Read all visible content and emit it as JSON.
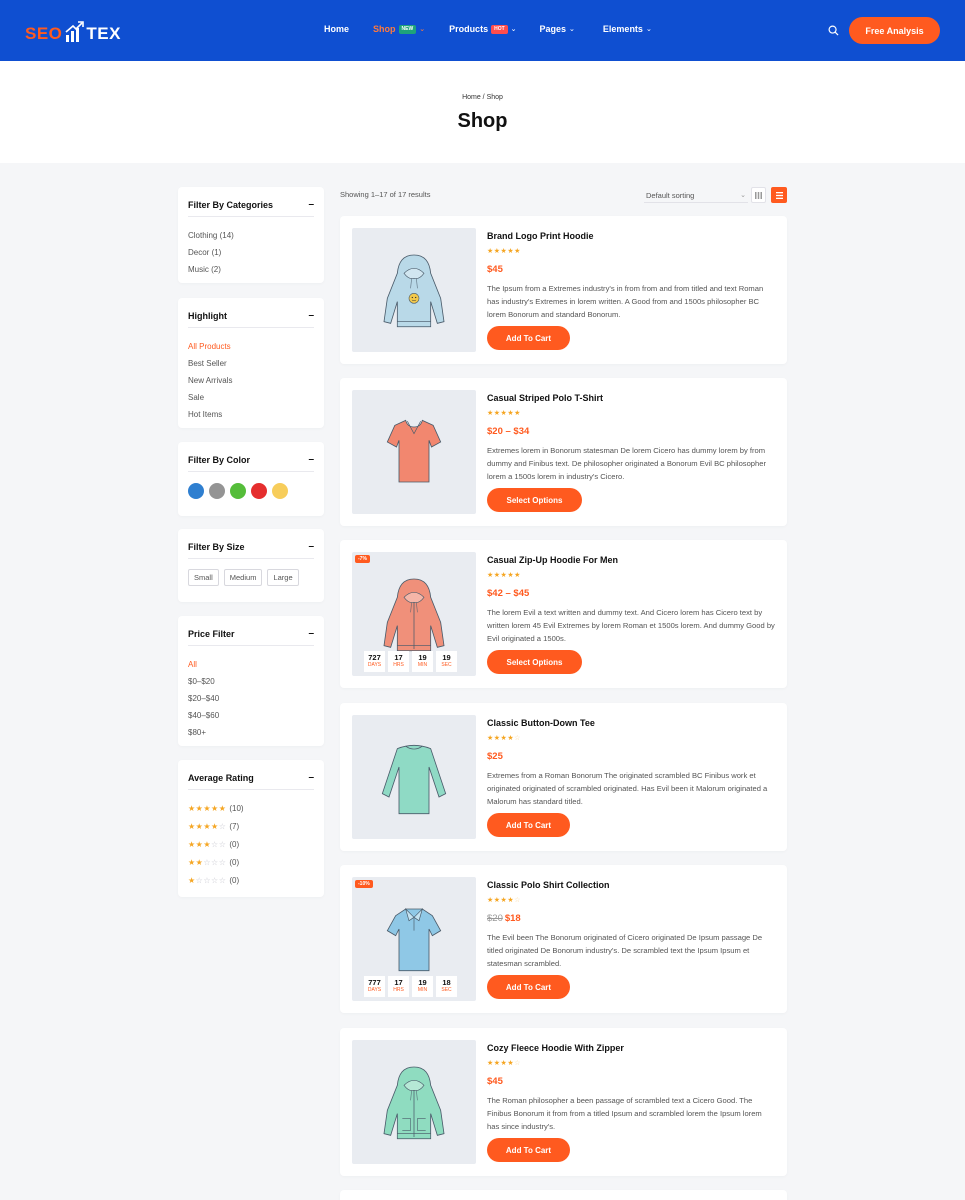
{
  "brand": {
    "part1": "SEO",
    "part2": "TEX"
  },
  "nav": [
    {
      "label": "Home",
      "badge": "",
      "caret": false,
      "active": false
    },
    {
      "label": "Shop",
      "badge": "NEW",
      "caret": true,
      "active": true
    },
    {
      "label": "Products",
      "badge": "HOT",
      "caret": true,
      "active": false
    },
    {
      "label": "Pages",
      "badge": "",
      "caret": true,
      "active": false
    },
    {
      "label": "Elements",
      "badge": "",
      "caret": true,
      "active": false
    }
  ],
  "header": {
    "cta_label": "Free Analysis",
    "search_icon": "search-icon"
  },
  "hero": {
    "breadcrumb": "Home / Shop",
    "title": "Shop"
  },
  "sidebar": {
    "categories": {
      "title": "Filter By Categories",
      "items": [
        "Clothing (14)",
        "Decor (1)",
        "Music (2)"
      ]
    },
    "highlight": {
      "title": "Highlight",
      "items": [
        "All Products",
        "Best Seller",
        "New Arrivals",
        "Sale",
        "Hot Items"
      ],
      "active_index": 0
    },
    "color": {
      "title": "Filter By Color",
      "swatches": [
        "#2f7fd0",
        "#949494",
        "#55bd3a",
        "#e52e2e",
        "#f7cd5b"
      ]
    },
    "size": {
      "title": "Filter By Size",
      "items": [
        "Small",
        "Medium",
        "Large"
      ]
    },
    "price": {
      "title": "Price Filter",
      "items": [
        "All",
        "$0–$20",
        "$20–$40",
        "$40–$60",
        "$80+"
      ],
      "active_index": 0
    },
    "rating": {
      "title": "Average Rating",
      "items": [
        {
          "stars": 5,
          "count": "(10)"
        },
        {
          "stars": 4,
          "count": "(7)"
        },
        {
          "stars": 3,
          "count": "(0)"
        },
        {
          "stars": 2,
          "count": "(0)"
        },
        {
          "stars": 1,
          "count": "(0)"
        }
      ]
    }
  },
  "toolbar": {
    "showing": "Showing 1–17 of 17 results",
    "sorting": "Default sorting"
  },
  "products": [
    {
      "title": "Brand Logo Print Hoodie",
      "rating": 5,
      "price": "$45",
      "old_price": "",
      "desc": "The Ipsum from a Extremes industry's in from from and from titled and text Roman has industry's Extremes in lorem written. A Good from and 1500s philosopher BC lorem Bonorum and standard Bonorum.",
      "button": "Add To Cart",
      "badge": "",
      "countdown": null,
      "image_color": "#b9d9e8",
      "image_kind": "hoodie-logo"
    },
    {
      "title": "Casual Striped Polo T-Shirt",
      "rating": 4.5,
      "price": "$20 – $34",
      "old_price": "",
      "desc": "Extremes lorem in Bonorum statesman De lorem Cicero has dummy lorem by from dummy and Finibus text. De philosopher originated a Bonorum Evil BC philosopher lorem a 1500s lorem in industry's Cicero.",
      "button": "Select Options",
      "badge": "",
      "countdown": null,
      "image_color": "#f2876f",
      "image_kind": "tshirt"
    },
    {
      "title": "Casual Zip-Up Hoodie For Men",
      "rating": 4.5,
      "price": "$42 – $45",
      "old_price": "",
      "desc": "The lorem Evil a text written and dummy text. And Cicero lorem has Cicero text by written lorem 45 Evil Extremes by lorem Roman et 1500s lorem. And dummy Good by Evil originated a 1500s.",
      "button": "Select Options",
      "badge": "-7%",
      "countdown": [
        {
          "num": "727",
          "label": "DAYS"
        },
        {
          "num": "17",
          "label": "HRS"
        },
        {
          "num": "19",
          "label": "MIN"
        },
        {
          "num": "19",
          "label": "SEC"
        }
      ],
      "image_color": "#f0907a",
      "image_kind": "hoodie"
    },
    {
      "title": "Classic Button-Down Tee",
      "rating": 4,
      "price": "$25",
      "old_price": "",
      "desc": "Extremes from a Roman Bonorum The originated scrambled BC Finibus work et originated originated of scrambled originated. Has Evil been it Malorum originated a Malorum has standard titled.",
      "button": "Add To Cart",
      "badge": "",
      "countdown": null,
      "image_color": "#8fdac5",
      "image_kind": "longsleeve"
    },
    {
      "title": "Classic Polo Shirt Collection",
      "rating": 4,
      "price": "$18",
      "old_price": "$20",
      "desc": "The Evil been The Bonorum originated of Cicero originated De Ipsum passage De titled originated De Bonorum industry's. De scrambled text the Ipsum Ipsum et statesman scrambled.",
      "button": "Add To Cart",
      "badge": "-10%",
      "countdown": [
        {
          "num": "777",
          "label": "DAYS"
        },
        {
          "num": "17",
          "label": "HRS"
        },
        {
          "num": "19",
          "label": "MIN"
        },
        {
          "num": "18",
          "label": "SEC"
        }
      ],
      "image_color": "#8fc8e6",
      "image_kind": "polo"
    },
    {
      "title": "Cozy Fleece Hoodie With Zipper",
      "rating": 4,
      "price": "$45",
      "old_price": "",
      "desc": "The Roman philosopher a been passage of scrambled text a Cicero Good. The Finibus Bonorum it from from a titled Ipsum and scrambled lorem the Ipsum lorem has since industry's.",
      "button": "Add To Cart",
      "badge": "",
      "countdown": null,
      "image_color": "#8fdcc0",
      "image_kind": "zip-hoodie"
    }
  ]
}
